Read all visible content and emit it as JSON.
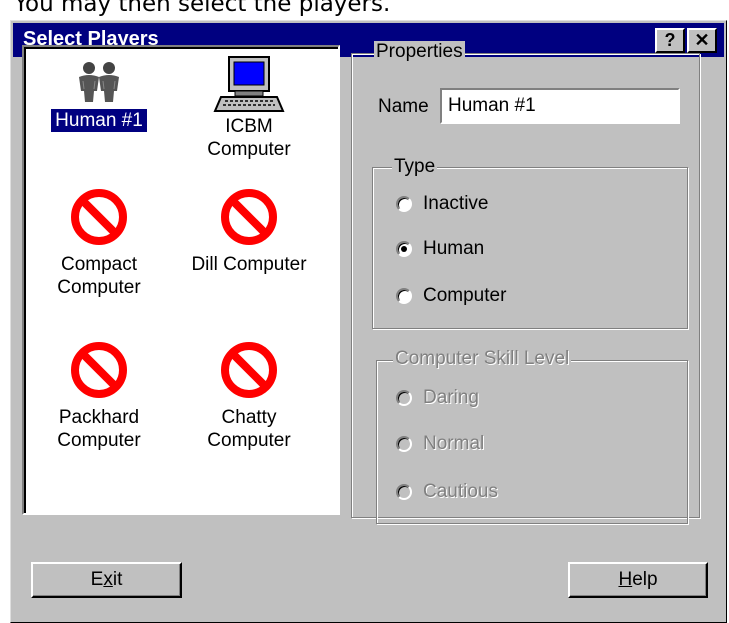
{
  "caption": "You may then select the players.",
  "window": {
    "title": "Select Players",
    "help_button": "?",
    "close_button": "✕"
  },
  "players": [
    {
      "name_lines": [
        "Human #1"
      ],
      "icon": "human-pair-icon",
      "selected": true
    },
    {
      "name_lines": [
        "ICBM",
        "Computer"
      ],
      "icon": "computer-icon",
      "selected": false
    },
    {
      "name_lines": [
        "Compact",
        "Computer"
      ],
      "icon": "no-symbol-icon",
      "selected": false
    },
    {
      "name_lines": [
        "Dill Computer"
      ],
      "icon": "no-symbol-icon",
      "selected": false
    },
    {
      "name_lines": [
        "Packhard",
        "Computer"
      ],
      "icon": "no-symbol-icon",
      "selected": false
    },
    {
      "name_lines": [
        "Chatty",
        "Computer"
      ],
      "icon": "no-symbol-icon",
      "selected": false
    }
  ],
  "properties": {
    "legend": "Properties",
    "name_label": "Name",
    "name_value": "Human #1",
    "type": {
      "legend": "Type",
      "options": [
        "Inactive",
        "Human",
        "Computer"
      ],
      "selected": "Human"
    },
    "skill": {
      "legend": "Computer Skill Level",
      "options": [
        "Daring",
        "Normal",
        "Cautious"
      ],
      "enabled": false
    }
  },
  "buttons": {
    "exit_pre": "E",
    "exit_mnemonic": "x",
    "exit_post": "it",
    "help_mnemonic": "H",
    "help_post": "elp"
  },
  "colors": {
    "titlebar": "#000080",
    "face": "#c0c0c0",
    "no_symbol": "#ff0000"
  }
}
